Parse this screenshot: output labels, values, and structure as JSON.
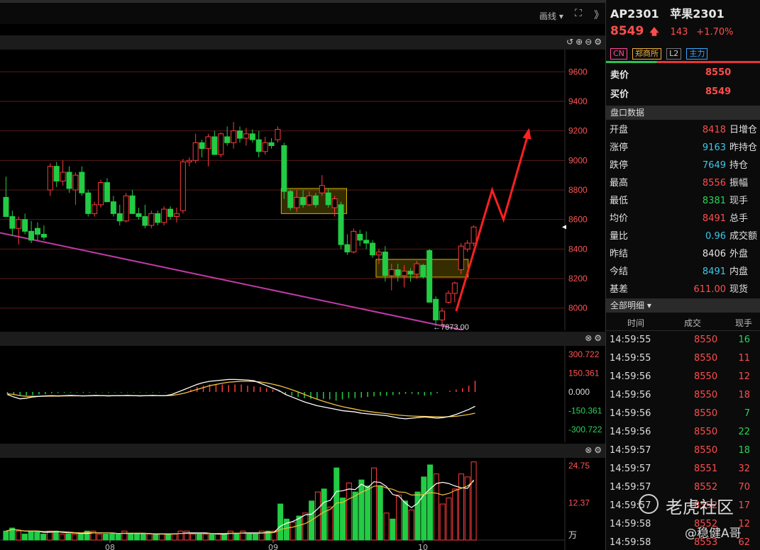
{
  "toolbar": {
    "draw_label": "画线 ▾",
    "expand_icon": "⛶",
    "more_icon": "》"
  },
  "main_panel": {
    "icons": "↺⊕⊖⚙",
    "y_ticks": [
      "9600",
      "9400",
      "9200",
      "9000",
      "8800",
      "8600",
      "8400",
      "8200",
      "8000"
    ],
    "low_label": "←7873.00"
  },
  "macd_panel": {
    "icons": "⊗⚙",
    "y_ticks": [
      "300.722",
      "150.361",
      "0.000",
      "-150.361",
      "-300.722"
    ]
  },
  "vol_panel": {
    "icons": "⊗⚙",
    "y_ticks": [
      "24.75",
      "12.37"
    ],
    "unit": "万",
    "x_ticks": [
      "08",
      "09",
      "10"
    ]
  },
  "colors": {
    "up": "#ff3b3b",
    "down": "#22cc44",
    "trend": "#c03aa6",
    "box": "#d4b400",
    "dif": "#ffffff",
    "dea": "#f0c040"
  },
  "chart_data": {
    "type": "candlestick",
    "ylim": [
      7850,
      9750
    ],
    "candles": [
      {
        "o": 8750,
        "h": 8890,
        "l": 8620,
        "c": 8620
      },
      {
        "o": 8620,
        "h": 8660,
        "l": 8490,
        "c": 8540
      },
      {
        "o": 8540,
        "h": 8620,
        "l": 8430,
        "c": 8600
      },
      {
        "o": 8600,
        "h": 8640,
        "l": 8500,
        "c": 8520
      },
      {
        "o": 8520,
        "h": 8590,
        "l": 8440,
        "c": 8460
      },
      {
        "o": 8540,
        "h": 8580,
        "l": 8460,
        "c": 8500
      },
      {
        "o": 8500,
        "h": 8560,
        "l": 8460,
        "c": 8480
      },
      {
        "o": 8800,
        "h": 8980,
        "l": 8760,
        "c": 8960
      },
      {
        "o": 8960,
        "h": 8990,
        "l": 8820,
        "c": 8860
      },
      {
        "o": 8860,
        "h": 9000,
        "l": 8830,
        "c": 8920
      },
      {
        "o": 8920,
        "h": 8960,
        "l": 8780,
        "c": 8810
      },
      {
        "o": 8800,
        "h": 8920,
        "l": 8700,
        "c": 8900
      },
      {
        "o": 8920,
        "h": 8960,
        "l": 8760,
        "c": 8780
      },
      {
        "o": 8780,
        "h": 8800,
        "l": 8620,
        "c": 8640
      },
      {
        "o": 8640,
        "h": 8720,
        "l": 8620,
        "c": 8700
      },
      {
        "o": 8700,
        "h": 8870,
        "l": 8680,
        "c": 8850
      },
      {
        "o": 8850,
        "h": 8880,
        "l": 8720,
        "c": 8720
      },
      {
        "o": 8720,
        "h": 8760,
        "l": 8620,
        "c": 8640
      },
      {
        "o": 8640,
        "h": 8700,
        "l": 8560,
        "c": 8590
      },
      {
        "o": 8590,
        "h": 8780,
        "l": 8580,
        "c": 8760
      },
      {
        "o": 8760,
        "h": 8800,
        "l": 8640,
        "c": 8640
      },
      {
        "o": 8640,
        "h": 8680,
        "l": 8600,
        "c": 8620
      },
      {
        "o": 8620,
        "h": 8700,
        "l": 8540,
        "c": 8560
      },
      {
        "o": 8560,
        "h": 8660,
        "l": 8540,
        "c": 8640
      },
      {
        "o": 8640,
        "h": 8660,
        "l": 8560,
        "c": 8580
      },
      {
        "o": 8580,
        "h": 8690,
        "l": 8560,
        "c": 8670
      },
      {
        "o": 8670,
        "h": 8690,
        "l": 8600,
        "c": 8620
      },
      {
        "o": 8620,
        "h": 8680,
        "l": 8580,
        "c": 8640
      },
      {
        "o": 8660,
        "h": 9010,
        "l": 8640,
        "c": 8990
      },
      {
        "o": 8990,
        "h": 9020,
        "l": 8960,
        "c": 9000
      },
      {
        "o": 9000,
        "h": 9180,
        "l": 8980,
        "c": 9120
      },
      {
        "o": 9120,
        "h": 9140,
        "l": 9020,
        "c": 9080
      },
      {
        "o": 9080,
        "h": 9180,
        "l": 8960,
        "c": 9160
      },
      {
        "o": 9160,
        "h": 9200,
        "l": 9040,
        "c": 9040
      },
      {
        "o": 9040,
        "h": 9190,
        "l": 9020,
        "c": 9180
      },
      {
        "o": 9160,
        "h": 9230,
        "l": 9100,
        "c": 9120
      },
      {
        "o": 9120,
        "h": 9260,
        "l": 9080,
        "c": 9200
      },
      {
        "o": 9200,
        "h": 9230,
        "l": 9120,
        "c": 9150
      },
      {
        "o": 9150,
        "h": 9220,
        "l": 9100,
        "c": 9180
      },
      {
        "o": 9180,
        "h": 9210,
        "l": 9120,
        "c": 9140
      },
      {
        "o": 9140,
        "h": 9200,
        "l": 9020,
        "c": 9060
      },
      {
        "o": 9060,
        "h": 9160,
        "l": 9040,
        "c": 9120
      },
      {
        "o": 9120,
        "h": 9150,
        "l": 9080,
        "c": 9100
      },
      {
        "o": 9140,
        "h": 9230,
        "l": 9120,
        "c": 9210
      },
      {
        "o": 9100,
        "h": 9120,
        "l": 8740,
        "c": 8790
      },
      {
        "o": 8790,
        "h": 8800,
        "l": 8660,
        "c": 8680
      },
      {
        "o": 8680,
        "h": 8800,
        "l": 8650,
        "c": 8750
      },
      {
        "o": 8750,
        "h": 8800,
        "l": 8680,
        "c": 8700
      },
      {
        "o": 8700,
        "h": 8790,
        "l": 8690,
        "c": 8760
      },
      {
        "o": 8760,
        "h": 8780,
        "l": 8680,
        "c": 8700
      },
      {
        "o": 8780,
        "h": 8900,
        "l": 8760,
        "c": 8830
      },
      {
        "o": 8780,
        "h": 8810,
        "l": 8680,
        "c": 8700
      },
      {
        "o": 8680,
        "h": 8760,
        "l": 8620,
        "c": 8740
      },
      {
        "o": 8700,
        "h": 8720,
        "l": 8400,
        "c": 8430
      },
      {
        "o": 8430,
        "h": 8500,
        "l": 8360,
        "c": 8380
      },
      {
        "o": 8380,
        "h": 8540,
        "l": 8370,
        "c": 8520
      },
      {
        "o": 8500,
        "h": 8530,
        "l": 8420,
        "c": 8460
      },
      {
        "o": 8460,
        "h": 8520,
        "l": 8400,
        "c": 8440
      },
      {
        "o": 8440,
        "h": 8460,
        "l": 8340,
        "c": 8360
      },
      {
        "o": 8360,
        "h": 8400,
        "l": 8300,
        "c": 8380
      },
      {
        "o": 8380,
        "h": 8420,
        "l": 8180,
        "c": 8220
      },
      {
        "o": 8220,
        "h": 8300,
        "l": 8120,
        "c": 8260
      },
      {
        "o": 8260,
        "h": 8300,
        "l": 8180,
        "c": 8220
      },
      {
        "o": 8220,
        "h": 8290,
        "l": 8140,
        "c": 8250
      },
      {
        "o": 8250,
        "h": 8270,
        "l": 8180,
        "c": 8230
      },
      {
        "o": 8230,
        "h": 8320,
        "l": 8200,
        "c": 8300
      },
      {
        "o": 8290,
        "h": 8300,
        "l": 8200,
        "c": 8210
      },
      {
        "o": 8390,
        "h": 8400,
        "l": 8040,
        "c": 8040
      },
      {
        "o": 8060,
        "h": 8080,
        "l": 7880,
        "c": 7920
      },
      {
        "o": 7920,
        "h": 8000,
        "l": 7873,
        "c": 7980
      },
      {
        "o": 8040,
        "h": 8120,
        "l": 8030,
        "c": 8100
      },
      {
        "o": 8100,
        "h": 8180,
        "l": 8040,
        "c": 8170
      },
      {
        "o": 8260,
        "h": 8440,
        "l": 8230,
        "c": 8420
      },
      {
        "o": 8400,
        "h": 8460,
        "l": 8380,
        "c": 8440
      },
      {
        "o": 8440,
        "h": 8560,
        "l": 8420,
        "c": 8549
      }
    ],
    "volumes": [
      3,
      4,
      3,
      2,
      3,
      3,
      2,
      3,
      3,
      2,
      2,
      2,
      2,
      3,
      3,
      2,
      2,
      2,
      2,
      3,
      2,
      2,
      2,
      2,
      2,
      2,
      2,
      2,
      3,
      3,
      2,
      2,
      2,
      2,
      2,
      2,
      3,
      2,
      3,
      2,
      2,
      3,
      3,
      3,
      12,
      7,
      6,
      8,
      9,
      13,
      16,
      17,
      11,
      24,
      14,
      19,
      16,
      20,
      18,
      24,
      18,
      9,
      7,
      15,
      13,
      10,
      16,
      21,
      25,
      22,
      12,
      14,
      17,
      22,
      21,
      26
    ],
    "macd_bars": [
      -20,
      -25,
      -30,
      -28,
      -25,
      -20,
      -18,
      -10,
      -8,
      -6,
      -5,
      -4,
      -6,
      -5,
      -4,
      -3,
      -5,
      -4,
      -5,
      -3,
      -4,
      -4,
      -3,
      -4,
      -3,
      -3,
      -2,
      -2,
      -1,
      20,
      40,
      50,
      60,
      60,
      60,
      55,
      60,
      60,
      50,
      45,
      40,
      30,
      20,
      10,
      -20,
      -30,
      -40,
      -50,
      -55,
      -60,
      -55,
      -60,
      -70,
      -60,
      -50,
      -50,
      -45,
      -40,
      -35,
      -30,
      -30,
      -25,
      -20,
      -15,
      -15,
      -20,
      -30,
      -25,
      -10,
      0,
      10,
      20,
      30,
      50,
      90
    ],
    "dif": [
      -20,
      -40,
      -55,
      -50,
      -40,
      -35,
      -32,
      -30,
      -32,
      -30,
      -28,
      -30,
      -32,
      -30,
      -28,
      -30,
      -32,
      -30,
      -30,
      -28,
      -30,
      -32,
      -30,
      -28,
      -30,
      -30,
      -20,
      0,
      20,
      40,
      60,
      75,
      85,
      90,
      95,
      100,
      100,
      98,
      95,
      90,
      70,
      50,
      30,
      10,
      -20,
      -40,
      -60,
      -80,
      -95,
      -110,
      -120,
      -130,
      -140,
      -150,
      -155,
      -160,
      -170,
      -175,
      -180,
      -185,
      -190,
      -200,
      -210,
      -215,
      -210,
      -205,
      -200,
      -205,
      -210,
      -205,
      -195,
      -180,
      -160,
      -140,
      -115
    ],
    "dea": [
      -15,
      -20,
      -30,
      -35,
      -35,
      -35,
      -34,
      -33,
      -33,
      -32,
      -31,
      -31,
      -31,
      -31,
      -30,
      -30,
      -30,
      -30,
      -30,
      -30,
      -30,
      -30,
      -30,
      -30,
      -30,
      -30,
      -28,
      -20,
      -10,
      5,
      20,
      35,
      50,
      60,
      70,
      78,
      82,
      85,
      85,
      84,
      80,
      72,
      62,
      50,
      35,
      18,
      0,
      -20,
      -40,
      -58,
      -75,
      -90,
      -105,
      -118,
      -128,
      -138,
      -148,
      -155,
      -162,
      -168,
      -174,
      -180,
      -186,
      -190,
      -193,
      -195,
      -196,
      -197,
      -199,
      -200,
      -198,
      -195,
      -188,
      -180,
      -170
    ]
  },
  "quote": {
    "symbol": "AP2301",
    "name": "苹果2301",
    "price": "8549",
    "change": "143",
    "change_pct": "+1.70%",
    "tags": [
      "CN",
      "郑商所",
      "L2",
      "主力"
    ],
    "ask_label": "卖价",
    "ask": "8550",
    "bid_label": "买价",
    "bid": "8549",
    "section_title": "盘口数据",
    "stats": [
      {
        "label": "开盘",
        "value": "8418",
        "cls": "red",
        "right": "日增仓"
      },
      {
        "label": "涨停",
        "value": "9163",
        "cls": "cyan",
        "right": "昨持仓"
      },
      {
        "label": "跌停",
        "value": "7649",
        "cls": "cyan",
        "right": "持仓"
      },
      {
        "label": "最高",
        "value": "8556",
        "cls": "red",
        "right": "振幅"
      },
      {
        "label": "最低",
        "value": "8381",
        "cls": "green",
        "right": "现手"
      },
      {
        "label": "均价",
        "value": "8491",
        "cls": "red",
        "right": "总手"
      },
      {
        "label": "量比",
        "value": "0.96",
        "cls": "cyan",
        "right": "成交额"
      },
      {
        "label": "昨结",
        "value": "8406",
        "cls": "white",
        "right": "外盘"
      },
      {
        "label": "今结",
        "value": "8491",
        "cls": "cyan",
        "right": "内盘"
      },
      {
        "label": "基差",
        "value": "611.00",
        "cls": "red",
        "right": "现货"
      }
    ],
    "detail_title": "全部明细 ▾",
    "detail_headers": [
      "时间",
      "成交",
      "现手"
    ],
    "trades": [
      {
        "t": "14:59:55",
        "p": "8550",
        "q": "16",
        "cls": "green"
      },
      {
        "t": "14:59:55",
        "p": "8550",
        "q": "11",
        "cls": "red"
      },
      {
        "t": "14:59:56",
        "p": "8550",
        "q": "12",
        "cls": "red"
      },
      {
        "t": "14:59:56",
        "p": "8550",
        "q": "18",
        "cls": "red"
      },
      {
        "t": "14:59:56",
        "p": "8550",
        "q": "7",
        "cls": "green"
      },
      {
        "t": "14:59:56",
        "p": "8550",
        "q": "22",
        "cls": "green"
      },
      {
        "t": "14:59:57",
        "p": "8550",
        "q": "18",
        "cls": "green"
      },
      {
        "t": "14:59:57",
        "p": "8551",
        "q": "32",
        "cls": "red"
      },
      {
        "t": "14:59:57",
        "p": "8552",
        "q": "70",
        "cls": "red"
      },
      {
        "t": "14:59:57",
        "p": "8552",
        "q": "17",
        "cls": "red"
      },
      {
        "t": "14:59:58",
        "p": "8552",
        "q": "12",
        "cls": "red"
      },
      {
        "t": "14:59:58",
        "p": "8553",
        "q": "62",
        "cls": "red"
      }
    ]
  },
  "watermark": {
    "brand": "老虎社区",
    "author": "@稳健A哥"
  }
}
